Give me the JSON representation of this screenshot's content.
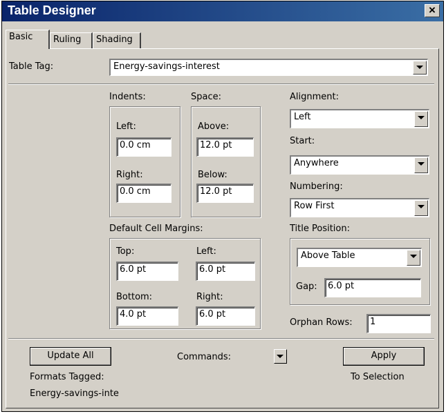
{
  "window": {
    "title": "Table Designer"
  },
  "tabs": [
    {
      "label": "Basic"
    },
    {
      "label": "Ruling"
    },
    {
      "label": "Shading"
    }
  ],
  "table_tag": {
    "label": "Table Tag:",
    "value": "Energy-savings-interest"
  },
  "indents": {
    "heading": "Indents:",
    "left_label": "Left:",
    "left_value": "0.0 cm",
    "right_label": "Right:",
    "right_value": "0.0 cm"
  },
  "space": {
    "heading": "Space:",
    "above_label": "Above:",
    "above_value": "12.0 pt",
    "below_label": "Below:",
    "below_value": "12.0 pt"
  },
  "alignment": {
    "label": "Alignment:",
    "value": "Left"
  },
  "start": {
    "label": "Start:",
    "value": "Anywhere"
  },
  "numbering": {
    "label": "Numbering:",
    "value": "Row First"
  },
  "cell_margins": {
    "heading": "Default Cell Margins:",
    "top_label": "Top:",
    "top_value": "6.0 pt",
    "left_label": "Left:",
    "left_value": "6.0 pt",
    "bottom_label": "Bottom:",
    "bottom_value": "4.0 pt",
    "right_label": "Right:",
    "right_value": "6.0 pt"
  },
  "title_position": {
    "label": "Title Position:",
    "value": "Above Table",
    "gap_label": "Gap:",
    "gap_value": "6.0 pt"
  },
  "orphan_rows": {
    "label": "Orphan Rows:",
    "value": "1"
  },
  "footer": {
    "update_all": "Update All",
    "commands_label": "Commands:",
    "apply": "Apply",
    "formats_tagged": "Formats Tagged:",
    "formats_value": "Energy-savings-inte",
    "to_selection": "To Selection"
  },
  "icons": {
    "close": "close-icon",
    "dropdown": "chevron-down-icon"
  }
}
